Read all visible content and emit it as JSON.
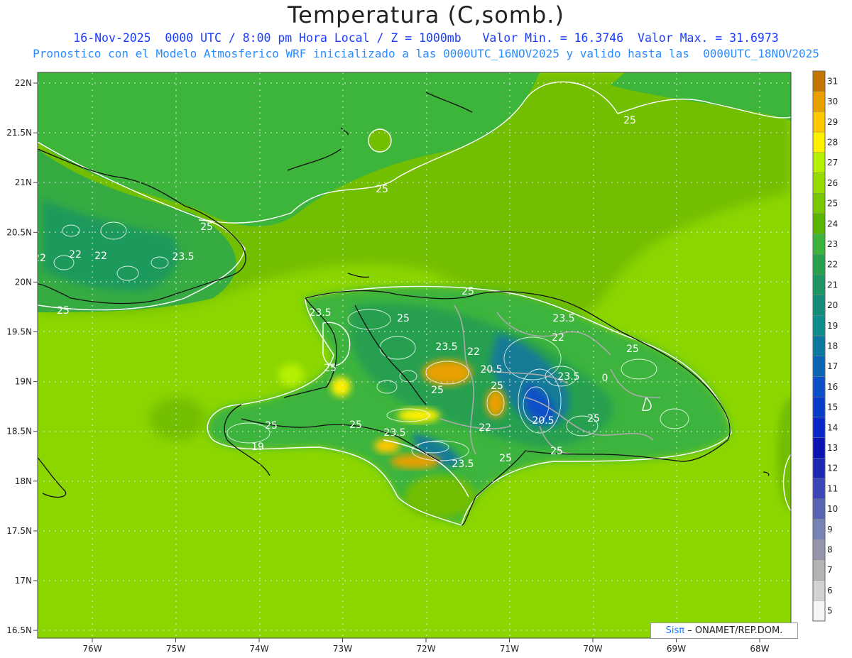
{
  "header": {
    "title": "Temperatura (C,somb.)",
    "line1": "16-Nov-2025  0000 UTC / 8:00 pm Hora Local / Z = 1000mb   Valor Min. = 16.3746  Valor Max. = 31.6973",
    "line2": "Pronostico con el Modelo Atmosferico WRF inicializado a las 0000UTC_16NOV2025 y valido hasta las  0000UTC_18NOV2025"
  },
  "axes": {
    "lat_labels": [
      "22N",
      "21.5N",
      "21N",
      "20.5N",
      "20N",
      "19.5N",
      "19N",
      "18.5N",
      "18N",
      "17.5N",
      "17N",
      "16.5N"
    ],
    "lon_labels": [
      "76W",
      "75W",
      "74W",
      "73W",
      "72W",
      "71W",
      "70W",
      "69W",
      "68W"
    ]
  },
  "colorbar": {
    "labels": [
      "31",
      "30",
      "29",
      "28",
      "27",
      "26",
      "25",
      "24",
      "23",
      "22",
      "21",
      "20",
      "19",
      "18",
      "17",
      "16",
      "15",
      "14",
      "13",
      "12",
      "11",
      "10",
      "9",
      "8",
      "7",
      "6",
      "5"
    ],
    "colors": [
      "#c07800",
      "#e8a000",
      "#ffc800",
      "#fff000",
      "#b4f000",
      "#96dc00",
      "#78c800",
      "#5ab400",
      "#3cb43c",
      "#28a050",
      "#1e9664",
      "#148c78",
      "#0f8c8c",
      "#0a78a0",
      "#0a64b4",
      "#0a50c8",
      "#0a3cc8",
      "#0a28c8",
      "#0a14b4",
      "#1e28b4",
      "#3c46b4",
      "#5a64b4",
      "#7882b4",
      "#9696aa",
      "#b4b4b4",
      "#d2d2d2",
      "#f5f5f5"
    ]
  },
  "contour_labels": [
    "25",
    "25",
    "25",
    "22",
    "22",
    "22",
    "23.5",
    "25",
    "25",
    "23.5",
    "25",
    "23.5",
    "22",
    "25",
    "25",
    "20.5",
    "25",
    "23.5",
    "22",
    "25",
    "0",
    "25",
    "25",
    "23.5",
    "23.5",
    "19",
    "22",
    "20.5",
    "25",
    "23.5",
    "25",
    "25"
  ],
  "credit": {
    "sis": "Sisπ",
    "org": "– ONAMET/REP.DOM."
  }
}
